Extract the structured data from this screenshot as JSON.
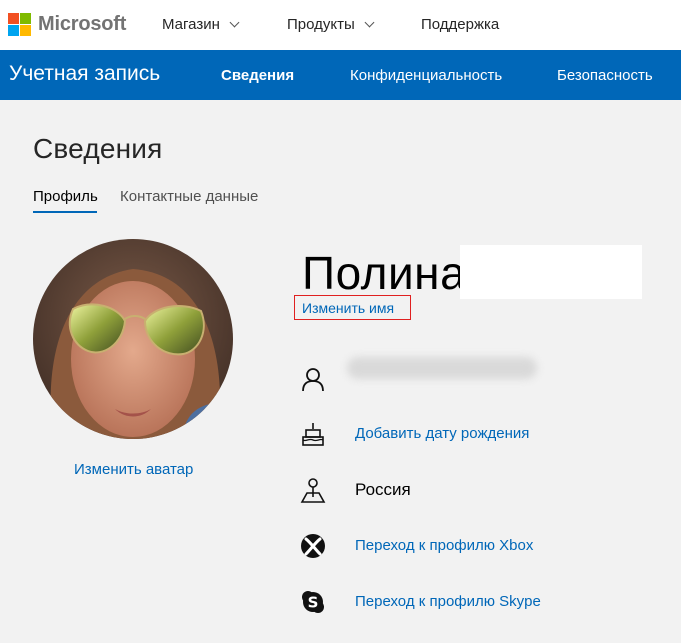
{
  "header": {
    "brand": "Microsoft",
    "brand_colors": [
      "#f25022",
      "#7fba00",
      "#00a4ef",
      "#ffb900"
    ],
    "nav": [
      {
        "label": "Магазин",
        "has_dropdown": true
      },
      {
        "label": "Продукты",
        "has_dropdown": true
      },
      {
        "label": "Поддержка",
        "has_dropdown": false
      }
    ]
  },
  "account_bar": {
    "title": "Учетная запись",
    "accent_color": "#0067b8",
    "tabs": [
      {
        "label": "Сведения",
        "active": true
      },
      {
        "label": "Конфиденциальность",
        "active": false
      },
      {
        "label": "Безопасность",
        "active": false
      }
    ]
  },
  "main": {
    "title": "Сведения",
    "subtabs": [
      {
        "label": "Профиль",
        "active": true
      },
      {
        "label": "Контактные данные",
        "active": false
      }
    ],
    "avatar": {
      "change_label": "Изменить аватар"
    },
    "profile": {
      "first_name": "Полина",
      "rename_label": "Изменить имя",
      "rows": [
        {
          "icon": "person-icon",
          "text": ""
        },
        {
          "icon": "birthday-cake-icon",
          "text": "Добавить дату рождения"
        },
        {
          "icon": "location-pin-icon",
          "text": "Россия"
        },
        {
          "icon": "xbox-icon",
          "text": "Переход к профилю Xbox"
        },
        {
          "icon": "skype-icon",
          "text": "Переход к профилю Skype"
        }
      ]
    }
  }
}
